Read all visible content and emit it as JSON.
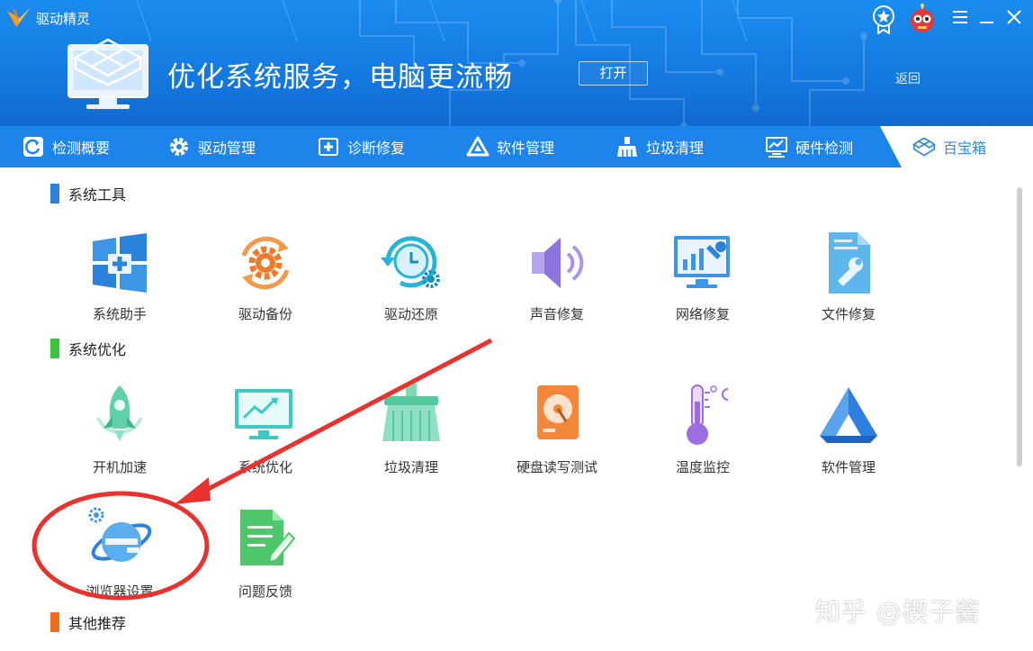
{
  "app": {
    "title": "驱动精灵"
  },
  "banner": {
    "headline": "优化系统服务，电脑更流畅",
    "open_label": "打开",
    "back_label": "返回"
  },
  "tabs": [
    {
      "label": "检测概要",
      "icon": "refresh-icon"
    },
    {
      "label": "驱动管理",
      "icon": "gear-icon"
    },
    {
      "label": "诊断修复",
      "icon": "medical-cross-icon"
    },
    {
      "label": "软件管理",
      "icon": "triangle-logo-icon"
    },
    {
      "label": "垃圾清理",
      "icon": "broom-icon"
    },
    {
      "label": "硬件检测",
      "icon": "monitor-chart-icon"
    },
    {
      "label": "百宝箱",
      "icon": "toolbox-cubes-icon",
      "active": true
    }
  ],
  "sections": {
    "system_tools": {
      "title": "系统工具",
      "color": "#2f7fe0",
      "items": [
        {
          "label": "系统助手",
          "icon": "windows-plus-icon"
        },
        {
          "label": "驱动备份",
          "icon": "gear-cycle-icon"
        },
        {
          "label": "驱动还原",
          "icon": "clock-restore-icon"
        },
        {
          "label": "声音修复",
          "icon": "speaker-icon"
        },
        {
          "label": "网络修复",
          "icon": "network-wrench-icon"
        },
        {
          "label": "文件修复",
          "icon": "file-wrench-icon"
        }
      ]
    },
    "system_optimize": {
      "title": "系统优化",
      "color": "#3cc43c",
      "items": [
        {
          "label": "开机加速",
          "icon": "rocket-icon"
        },
        {
          "label": "系统优化",
          "icon": "monitor-trend-icon"
        },
        {
          "label": "垃圾清理",
          "icon": "broom-icon"
        },
        {
          "label": "硬盘读写测试",
          "icon": "hard-disk-icon"
        },
        {
          "label": "温度监控",
          "icon": "thermometer-icon"
        },
        {
          "label": "软件管理",
          "icon": "triangle-logo-icon"
        },
        {
          "label": "浏览器设置",
          "icon": "ie-browser-icon"
        },
        {
          "label": "问题反馈",
          "icon": "feedback-document-icon"
        }
      ]
    },
    "other": {
      "title": "其他推荐",
      "color": "#f06a1a"
    }
  },
  "watermark": "知乎 @楔子酱"
}
